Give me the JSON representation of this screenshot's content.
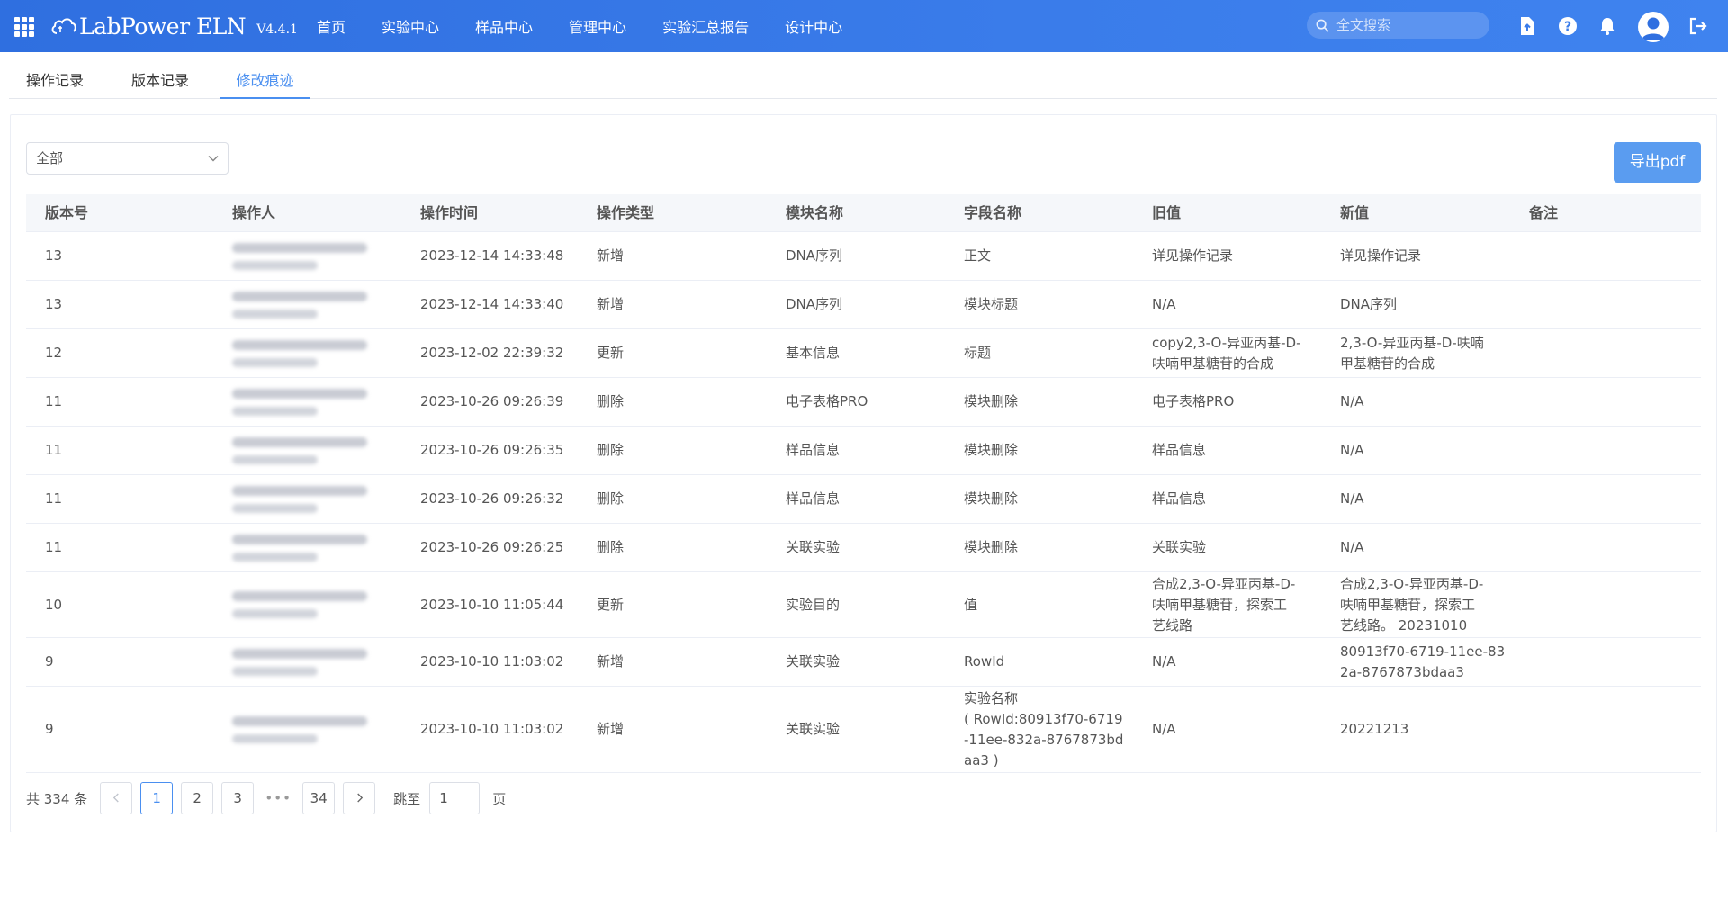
{
  "app": {
    "brand_name": "LabPower ELN",
    "version": "V4.4.1",
    "nav": [
      "首页",
      "实验中心",
      "样品中心",
      "管理中心",
      "实验汇总报告",
      "设计中心"
    ],
    "search_placeholder": "全文搜索",
    "icons": [
      "apps-grid-icon",
      "export-file-icon",
      "help-icon",
      "notification-bell-icon",
      "user-avatar-icon",
      "logout-icon"
    ]
  },
  "tabs": [
    "操作记录",
    "版本记录",
    "修改痕迹"
  ],
  "active_tab": "修改痕迹",
  "filter": {
    "selected": "全部"
  },
  "export_button": "导出pdf",
  "table": {
    "columns": [
      "版本号",
      "操作人",
      "操作时间",
      "操作类型",
      "模块名称",
      "字段名称",
      "旧值",
      "新值",
      "备注"
    ],
    "rows": [
      {
        "version": "13",
        "time": "2023-12-14 14:33:48",
        "type": "新增",
        "module": "DNA序列",
        "field": "正文",
        "old": "详见操作记录",
        "new": "详见操作记录",
        "note": ""
      },
      {
        "version": "13",
        "time": "2023-12-14 14:33:40",
        "type": "新增",
        "module": "DNA序列",
        "field": "模块标题",
        "old": "N/A",
        "new": "DNA序列",
        "note": ""
      },
      {
        "version": "12",
        "time": "2023-12-02 22:39:32",
        "type": "更新",
        "module": "基本信息",
        "field": "标题",
        "old": "copy2,3-O-异亚丙基-D-\n呋喃甲基糖苷的合成",
        "new": "2,3-O-异亚丙基-D-呋喃\n甲基糖苷的合成",
        "note": ""
      },
      {
        "version": "11",
        "time": "2023-10-26 09:26:39",
        "type": "删除",
        "module": "电子表格PRO",
        "field": "模块删除",
        "old": "电子表格PRO",
        "new": "N/A",
        "note": ""
      },
      {
        "version": "11",
        "time": "2023-10-26 09:26:35",
        "type": "删除",
        "module": "样品信息",
        "field": "模块删除",
        "old": "样品信息",
        "new": "N/A",
        "note": ""
      },
      {
        "version": "11",
        "time": "2023-10-26 09:26:32",
        "type": "删除",
        "module": "样品信息",
        "field": "模块删除",
        "old": "样品信息",
        "new": "N/A",
        "note": ""
      },
      {
        "version": "11",
        "time": "2023-10-26 09:26:25",
        "type": "删除",
        "module": "关联实验",
        "field": "模块删除",
        "old": "关联实验",
        "new": "N/A",
        "note": ""
      },
      {
        "version": "10",
        "time": "2023-10-10 11:05:44",
        "type": "更新",
        "module": "实验目的",
        "field": "值",
        "old": "合成2,3-O-异亚丙基-D-\n呋喃甲基糖苷，探索工\n艺线路",
        "new": "合成2,3-O-异亚丙基-D-\n呋喃甲基糖苷，探索工\n艺线路。 20231010",
        "note": ""
      },
      {
        "version": "9",
        "time": "2023-10-10 11:03:02",
        "type": "新增",
        "module": "关联实验",
        "field": "RowId",
        "old": "N/A",
        "new": "80913f70-6719-11ee-83\n2a-8767873bdaa3",
        "note": ""
      },
      {
        "version": "9",
        "time": "2023-10-10 11:03:02",
        "type": "新增",
        "module": "关联实验",
        "field": "实验名称\n( RowId:80913f70-6719\n-11ee-832a-8767873bd\naa3 )",
        "old": "N/A",
        "new": "20221213",
        "note": ""
      }
    ]
  },
  "pagination": {
    "total_label": "共 334 条",
    "pages": [
      "1",
      "2",
      "3"
    ],
    "ellipsis": "•••",
    "last_page": "34",
    "current": "1",
    "jump_label": "跳至",
    "jump_value": "1",
    "page_suffix": "页"
  }
}
